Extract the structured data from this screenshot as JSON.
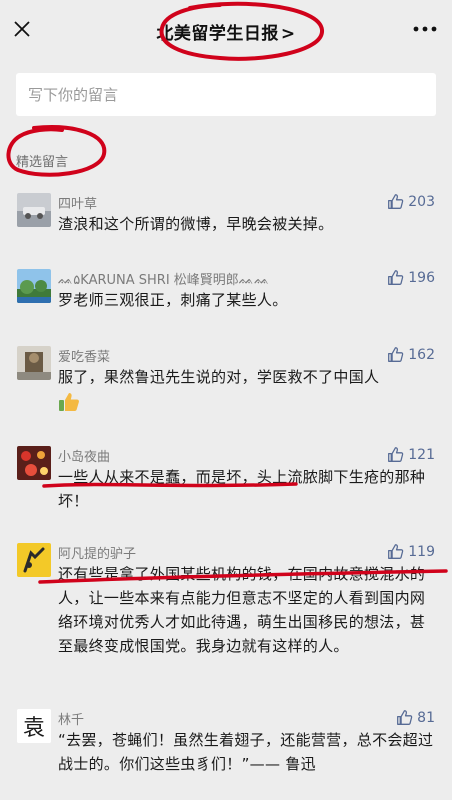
{
  "header": {
    "title": "北美留学生日报",
    "chevron": ">"
  },
  "input": {
    "placeholder": "写下你的留言"
  },
  "section": {
    "label": "精选留言"
  },
  "comments": [
    {
      "name": "四叶草",
      "likes": "203",
      "text": "渣浪和这个所谓的微博，早晚会被关掉。"
    },
    {
      "name": "ᨐ۵KARUNA SHRI 松峰賢明郎ᨐᨐ",
      "likes": "196",
      "text": "罗老师三观很正，刺痛了某些人。"
    },
    {
      "name": "爱吃香菜",
      "likes": "162",
      "text": "服了，果然鲁迅先生说的对，学医救不了中国人"
    },
    {
      "name": "小岛夜曲",
      "likes": "121",
      "text": "一些人从来不是蠢，而是坏，头上流脓脚下生疮的那种坏！"
    },
    {
      "name": "阿凡提的驴子",
      "likes": "119",
      "text": "还有些是拿了外国某些机构的钱，在国内故意搅混水的人，让一些本来有点能力但意志不坚定的人看到国内网络环境对优秀人才如此待遇，萌生出国移民的想法，甚至最终变成恨国党。我身边就有这样的人。"
    },
    {
      "name": "林千",
      "likes": "81",
      "text": "“去罢，苍蝇们！虽然生着翅子，还能营营，总不会超过战士的。你们这些虫豸们！”—— 鲁迅"
    }
  ],
  "avatar_glyph": "袁",
  "colors": {
    "background": "#ededed",
    "link": "#576b95",
    "annotation": "#d0021b"
  }
}
